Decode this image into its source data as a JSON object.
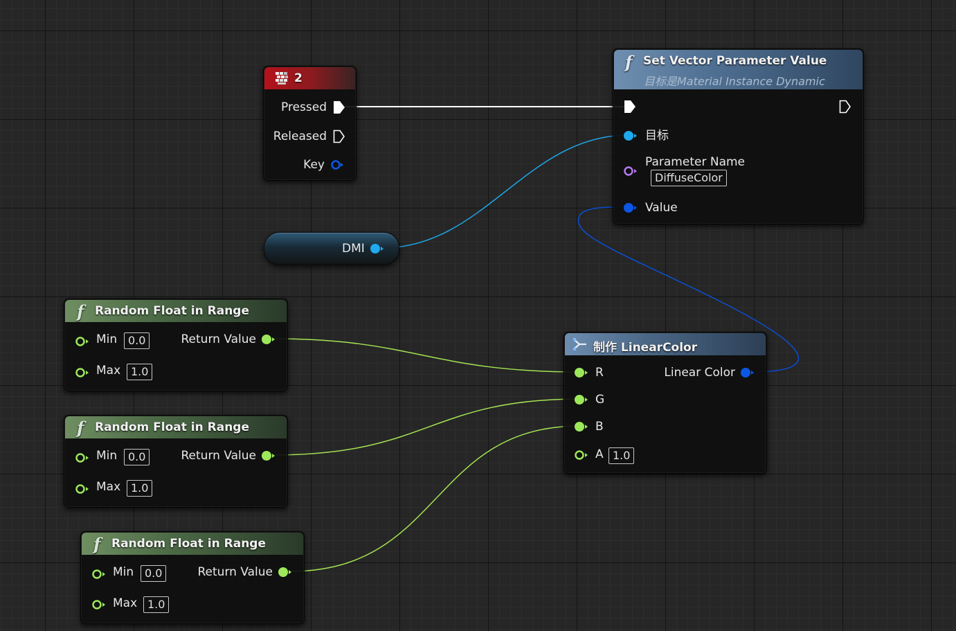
{
  "colors": {
    "float_pin": "#9ce85a",
    "object_pin": "#1fa9ee",
    "struct_pin": "#0c57e4",
    "name_pin": "#b57aee",
    "exec_pin": "#ffffff",
    "wire_float": "#a5e453",
    "wire_object": "#1ea7e8",
    "wire_struct": "#0b4fd6",
    "wire_exec": "#ffffff"
  },
  "key_event": {
    "title": "2",
    "icon": "keyboard-icon",
    "pins": {
      "pressed": "Pressed",
      "released": "Released",
      "key": "Key"
    }
  },
  "set_vector": {
    "title": "Set Vector Parameter Value",
    "subtitle": "目标是Material Instance Dynamic",
    "pins": {
      "target": "目标",
      "parameter_name": "Parameter Name",
      "parameter_name_value": "DiffuseColor",
      "value": "Value"
    }
  },
  "dmi": {
    "label": "DMI"
  },
  "make_color": {
    "title": "制作 LinearColor",
    "pins": {
      "r": "R",
      "g": "G",
      "b": "B",
      "a": "A",
      "a_value": "1.0",
      "out": "Linear Color"
    }
  },
  "random_nodes": [
    {
      "title": "Random Float in Range",
      "min_label": "Min",
      "min_value": "0.0",
      "max_label": "Max",
      "max_value": "1.0",
      "out": "Return Value"
    },
    {
      "title": "Random Float in Range",
      "min_label": "Min",
      "min_value": "0.0",
      "max_label": "Max",
      "max_value": "1.0",
      "out": "Return Value"
    },
    {
      "title": "Random Float in Range",
      "min_label": "Min",
      "min_value": "0.0",
      "max_label": "Max",
      "max_value": "1.0",
      "out": "Return Value"
    }
  ]
}
